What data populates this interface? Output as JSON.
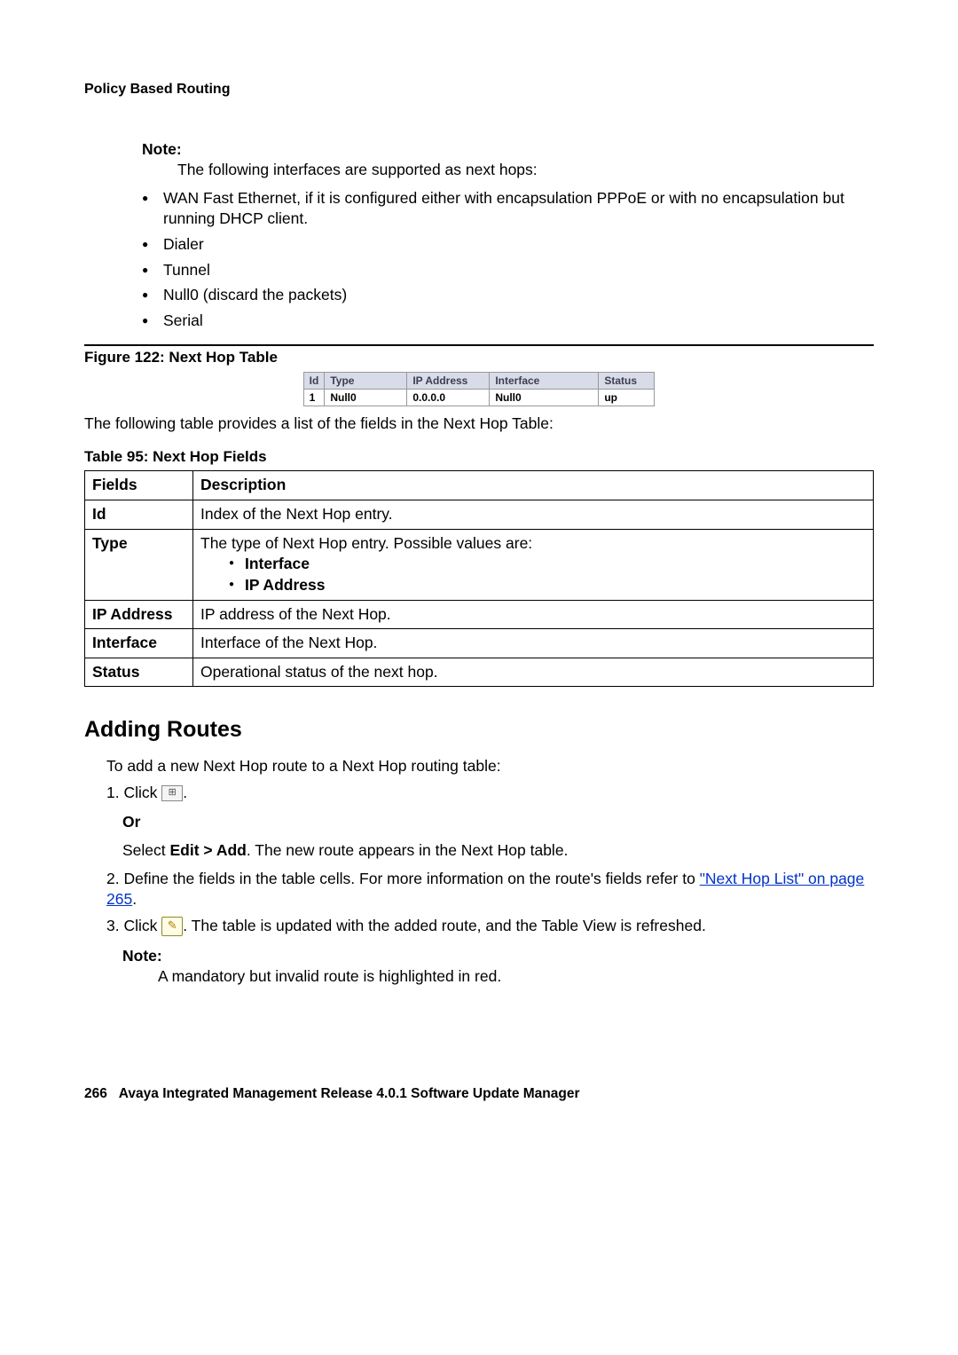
{
  "header": "Policy Based Routing",
  "note1": {
    "label": "Note:",
    "text": "The following interfaces are supported as next hops:",
    "items": [
      "WAN Fast Ethernet, if it is configured either with encapsulation PPPoE or with no encapsulation but running DHCP client.",
      "Dialer",
      "Tunnel",
      "Null0 (discard the packets)",
      "Serial"
    ]
  },
  "figure": {
    "caption": "Figure 122: Next Hop Table",
    "headers": [
      "Id",
      "Type",
      "IP Address",
      "Interface",
      "Status"
    ],
    "row": [
      "1",
      "Null0",
      "0.0.0.0",
      "Null0",
      "up"
    ]
  },
  "intro_para": "The following table provides a list of the fields in the Next Hop Table:",
  "desc_table": {
    "caption": "Table 95: Next Hop Fields",
    "headers": [
      "Fields",
      "Description"
    ],
    "rows": [
      {
        "field": "Id",
        "desc": "Index of the Next Hop entry."
      },
      {
        "field": "Type",
        "desc_prefix": "The type of Next Hop entry. Possible values are:",
        "sub": [
          "Interface",
          "IP Address"
        ]
      },
      {
        "field": "IP Address",
        "desc": "IP address of the Next Hop."
      },
      {
        "field": "Interface",
        "desc": "Interface of the Next Hop."
      },
      {
        "field": "Status",
        "desc": "Operational status of the next hop."
      }
    ]
  },
  "section": {
    "heading": "Adding Routes",
    "intro": "To add a new Next Hop route to a Next Hop routing table:",
    "step1_a": "1. Click ",
    "step1_b": ".",
    "or": "Or",
    "select_prefix": "Select ",
    "select_bold": "Edit > Add",
    "select_suffix": ". The new route appears in the Next Hop table.",
    "step2_a": "2. Define the fields in the table cells. For more information on the route's fields refer to ",
    "step2_link": "\"Next Hop List\" on page 265",
    "step2_b": ".",
    "step3_a": "3. Click ",
    "step3_b": ". The table is updated with the added route, and the Table View is refreshed."
  },
  "note2": {
    "label": "Note:",
    "text": "A mandatory but invalid route is highlighted in red."
  },
  "footer": {
    "page": "266",
    "text": "Avaya Integrated Management Release 4.0.1 Software Update Manager"
  }
}
